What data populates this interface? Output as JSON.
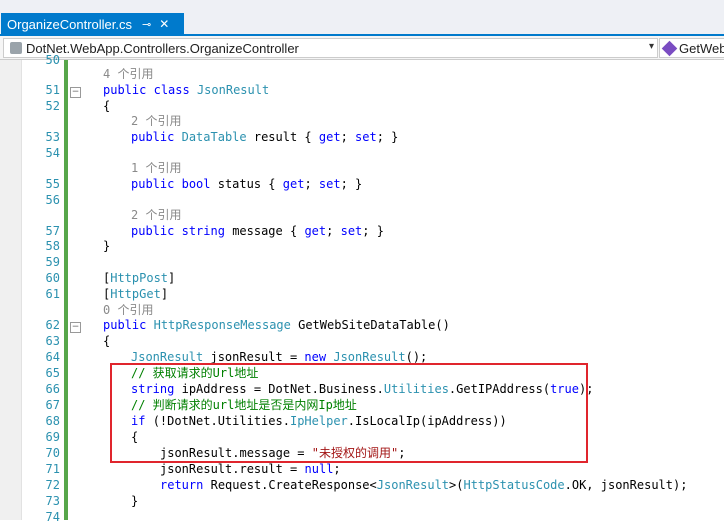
{
  "editor": {
    "tab": {
      "title": "OrganizeController.cs",
      "pin_icon": "pin-icon",
      "close_glyph": "✕"
    },
    "nav_left": "DotNet.WebApp.Controllers.OrganizeController",
    "nav_right": "GetWeb",
    "line_numbers": [
      "50",
      "51",
      "52",
      "53",
      "54",
      "55",
      "56",
      "57",
      "58",
      "59",
      "60",
      "61",
      "62",
      "63",
      "64",
      "65",
      "66",
      "67",
      "68",
      "69",
      "70",
      "71",
      "72",
      "73",
      "74"
    ],
    "code": {
      "ref4": "4 个引用",
      "l51_public": "public",
      "l51_class": "class",
      "l51_name": "JsonResult",
      "l52": "{",
      "ref2a": "2 个引用",
      "l53_public": "public",
      "l53_type": "DataTable",
      "l53_rest": "result {",
      "l53_get": "get",
      "l53_set": "set",
      "l53_end": "}",
      "ref1": "1 个引用",
      "l55_public": "public",
      "l55_bool": "bool",
      "l55_rest": "status {",
      "l55_get": "get",
      "l55_set": "set",
      "l55_end": "}",
      "ref2b": "2 个引用",
      "l57_public": "public",
      "l57_string": "string",
      "l57_rest": "message {",
      "l57_get": "get",
      "l57_set": "set",
      "l57_end": "}",
      "l58": "}",
      "l60_attr": "HttpPost",
      "l61_attr": "HttpGet",
      "ref0": "0 个引用",
      "l62_public": "public",
      "l62_type": "HttpResponseMessage",
      "l62_rest": "GetWebSiteDataTable()",
      "l63": "{",
      "l64_type": "JsonResult",
      "l64_mid": "jsonResult =",
      "l64_new": "new",
      "l64_type2": "JsonResult",
      "l64_end": "();",
      "l65_comment": "// 获取请求的Url地址",
      "l66_string": "string",
      "l66_a": "ipAddress = DotNet.Business.",
      "l66_util": "Utilities",
      "l66_b": ".GetIPAddress(",
      "l66_true": "true",
      "l66_c": ");",
      "l67_comment": "// 判断请求的url地址是否是内网Ip地址",
      "l68_if": "if",
      "l68_a": "(!DotNet.Utilities.",
      "l68_ip": "IpHelper",
      "l68_b": ".IsLocalIp(ipAddress))",
      "l69": "{",
      "l70_a": "jsonResult.message =",
      "l70_str": "\"未授权的调用\"",
      "l70_b": ";",
      "l71_a": "jsonResult.result =",
      "l71_null": "null",
      "l71_b": ";",
      "l72_return": "return",
      "l72_a": "Request.CreateResponse<",
      "l72_type": "JsonResult",
      "l72_b": ">(",
      "l72_type2": "HttpStatusCode",
      "l72_c": ".OK, jsonResult);",
      "l73": "}"
    }
  },
  "colors": {
    "accent": "#007acc",
    "keyword": "#0000ff",
    "type": "#2b91af",
    "comment": "#008000",
    "string": "#a31515",
    "changebar": "#57a64a",
    "highlight_box": "#e0252d"
  }
}
